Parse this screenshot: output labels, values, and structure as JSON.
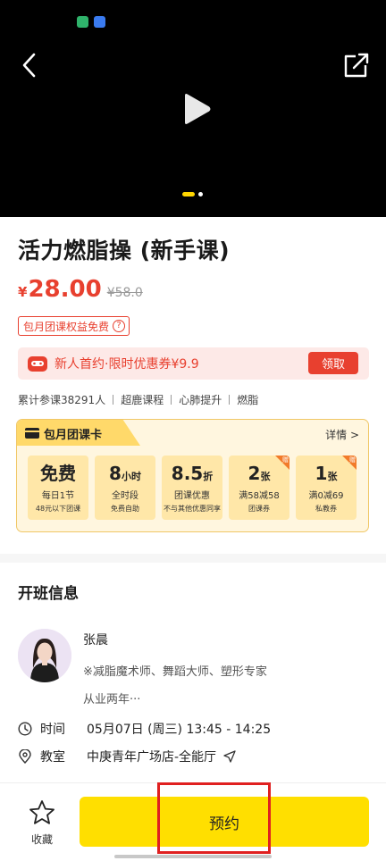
{
  "video": {
    "back_icon": "chevron-left-icon",
    "share_icon": "share-icon",
    "play_icon": "play-icon",
    "carousel": {
      "count": 2,
      "active": 1
    }
  },
  "course": {
    "title": "活力燃脂操 (新手课)",
    "currency": "¥",
    "price": "28.00",
    "original_price": "¥58.0",
    "benefit_tag": "包月团课权益免费",
    "benefit_tag_icon": "?",
    "coupon": {
      "text": "新人首约·限时优惠券¥9.9",
      "button": "领取"
    },
    "tags": [
      "累计参课38291人",
      "超鹿课程",
      "心肺提升",
      "燃脂"
    ]
  },
  "membership": {
    "title": "包月团课卡",
    "detail_link": "详情 >",
    "benefits": [
      {
        "big": "免费",
        "unit": "",
        "line1": "每日1节",
        "line2": "48元以下团课",
        "corner": ""
      },
      {
        "big": "8",
        "unit": "小时",
        "line1": "全时段",
        "line2": "免费自助",
        "corner": ""
      },
      {
        "big": "8.5",
        "unit": "折",
        "line1": "团课优惠",
        "line2": "不与其他优惠同享",
        "corner": ""
      },
      {
        "big": "2",
        "unit": "张",
        "line1": "满58减58",
        "line2": "团课券",
        "corner": "赠"
      },
      {
        "big": "1",
        "unit": "张",
        "line1": "满0减69",
        "line2": "私教券",
        "corner": "赠"
      }
    ]
  },
  "class_info": {
    "section_title": "开班信息",
    "coach": {
      "name": "张晨",
      "titles": "※减脂魔术师、舞蹈大师、塑形专家",
      "years": "从业两年···"
    },
    "time_label": "时间",
    "time_value": "05月07日 (周三) 13:45 - 14:25",
    "room_label": "教室",
    "room_value": "中庚青年广场店-全能厅"
  },
  "bottom_bar": {
    "favorite_label": "收藏",
    "book_label": "预约"
  },
  "colors": {
    "accent_red": "#e8402f",
    "brand_yellow": "#ffdf00",
    "highlight_red": "#e02020"
  }
}
